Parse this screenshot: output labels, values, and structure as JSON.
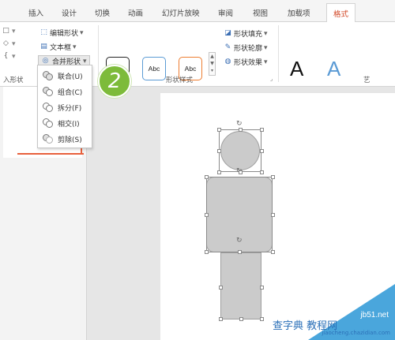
{
  "colors": {
    "accent": "#d24726",
    "badge": "#7dbb3a",
    "shape_fill": "#cbcbcb",
    "style1": "#222222",
    "style2": "#5b9bd5",
    "style3": "#ed7d31",
    "wordart_blue": "#5b9bd5",
    "watermark_blue": "#4aa6dc"
  },
  "ribbon_tabs": [
    "插入",
    "设计",
    "切换",
    "动画",
    "幻灯片放映",
    "审阅",
    "视图",
    "加载项",
    "格式"
  ],
  "active_tab": "格式",
  "insert_group": {
    "edit_shape": "编辑形状",
    "text_box": "文本框",
    "merge_shapes": "合并形状",
    "label_fragment": "入形状",
    "edit_shape_icon": "edit-shape-icon",
    "text_box_icon": "text-box-icon",
    "merge_icon": "merge-shapes-icon"
  },
  "shape_styles": {
    "label": "形状样式",
    "swatches": [
      "Abc",
      "Abc",
      "Abc"
    ],
    "fill": "形状填充",
    "outline": "形状轮廓",
    "effects": "形状效果"
  },
  "wordart": {
    "letters": [
      "A",
      "A"
    ],
    "label_fragment": "艺"
  },
  "merge_menu": {
    "items": [
      {
        "label": "联合(U)",
        "icon": "union-icon"
      },
      {
        "label": "组合(C)",
        "icon": "combine-icon"
      },
      {
        "label": "拆分(F)",
        "icon": "fragment-icon"
      },
      {
        "label": "相交(I)",
        "icon": "intersect-icon"
      },
      {
        "label": "剪除(S)",
        "icon": "subtract-icon"
      }
    ]
  },
  "step_badge": "2",
  "watermark": {
    "site": "jb51.net",
    "title": "查字典 教程网",
    "url": "jiaocheng.chazidian.com"
  }
}
